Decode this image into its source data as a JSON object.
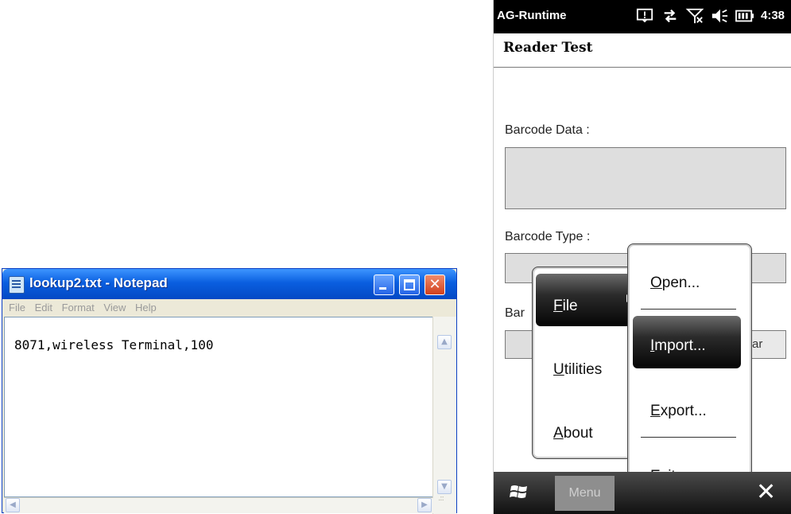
{
  "notepad": {
    "title": "lookup2.txt - Notepad",
    "menu": [
      "File",
      "Edit",
      "Format",
      "View",
      "Help"
    ],
    "content": "8071,wireless Terminal,100"
  },
  "device": {
    "status_title": "AG-Runtime",
    "time": "4:38",
    "app_title": "Reader Test",
    "barcode_data_label": "Barcode Data :",
    "barcode_type_label": "Barcode Type :",
    "barcode_partial_label": "Bar",
    "clear_partial": "ar",
    "menu_key": "Menu",
    "close_key": "✕",
    "main_menu": {
      "file": {
        "underline": "F",
        "rest": "ile"
      },
      "utilities": {
        "underline": "U",
        "rest": "tilities"
      },
      "about": {
        "underline": "A",
        "rest": "bout"
      }
    },
    "file_menu": {
      "open": {
        "underline": "O",
        "rest": "pen..."
      },
      "import": {
        "underline": "I",
        "rest": "mport..."
      },
      "export": {
        "underline": "E",
        "rest": "xport..."
      },
      "exit": {
        "pre": "E",
        "underline": "x",
        "rest": "it"
      }
    },
    "colors": {
      "highlight": "#1a1a1a",
      "field_bg": "#dedede",
      "status_bar": "#000000"
    }
  }
}
